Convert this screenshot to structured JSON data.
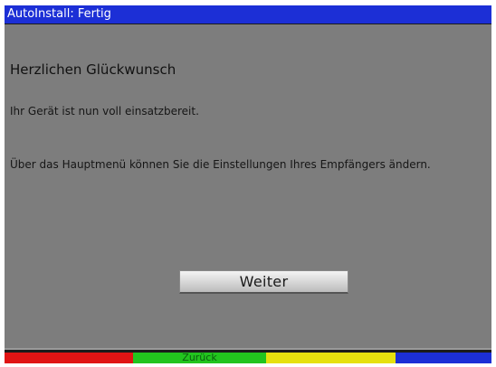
{
  "window": {
    "title": "AutoInstall: Fertig"
  },
  "main": {
    "heading": "Herzlichen Glückwunsch",
    "ready_text": "Ihr Gerät ist nun voll einsatzbereit.",
    "menu_text": "Über das Hauptmenü können Sie die Einstellungen Ihres Empfängers ändern."
  },
  "button": {
    "label": "Weiter"
  },
  "color_keys": {
    "red": {
      "label": "",
      "color": "#e01414"
    },
    "green": {
      "label": "Zurück",
      "color": "#22c41e"
    },
    "yellow": {
      "label": "",
      "color": "#e6e00e"
    },
    "blue": {
      "label": "",
      "color": "#1c2fd6"
    }
  },
  "colors": {
    "title_bar": "#1c2fd6",
    "panel": "#7d7d7d"
  }
}
